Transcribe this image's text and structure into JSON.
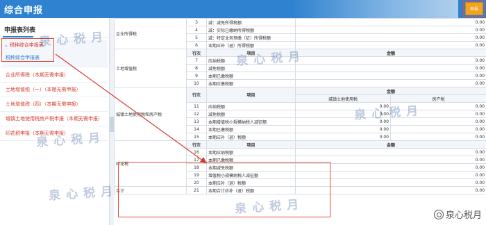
{
  "header": {
    "title": "综合申报",
    "submit_label": "申报"
  },
  "sidebar": {
    "title": "申报表列表",
    "group_label": "税种综合申报表",
    "group_child": "税种综合申报表",
    "items": [
      "企业所得税（本期无需申报）",
      "土地增值税（一）（本期无需申报）",
      "土地增值税（四）（本期无需申报）",
      "城镇土地使用税房产税申报（本期无需申报）",
      "印花税申报（本期无需申报）"
    ]
  },
  "table": {
    "header_item": "项目",
    "header_row": "行次",
    "header_amount": "金额",
    "header_land_tax": "城镇土地使用税",
    "header_property_tax": "房产税",
    "categories": {
      "enterprise": "企业所得税",
      "land_vat": "土地增值税",
      "land_use": "城镇土地使用税和房产税",
      "stamp": "印花税",
      "total": "合计"
    },
    "enterprise_rows": [
      {
        "no": "3",
        "item": "减：减免所得税额",
        "value": "0.00"
      },
      {
        "no": "4",
        "item": "减：实际已缴纳所得税额",
        "value": "0.00"
      },
      {
        "no": "5",
        "item": "减：特定业务预缴（征）所得税额",
        "value": "0.00"
      },
      {
        "no": "6",
        "item": "本期应补（退）所得税额",
        "value": "0.00"
      }
    ],
    "land_vat_rows": [
      {
        "no": "7",
        "item": "应纳税额",
        "value": "0.00"
      },
      {
        "no": "8",
        "item": "减免税额",
        "value": "0.00"
      },
      {
        "no": "9",
        "item": "本期已缴税额",
        "value": "0.00"
      },
      {
        "no": "10",
        "item": "本期应缴税额",
        "value": "0.00"
      }
    ],
    "land_use_rows": [
      {
        "no": "11",
        "item": "应纳税额",
        "land": "0.00",
        "prop": "0.00"
      },
      {
        "no": "12",
        "item": "减免税额",
        "land": "0.00",
        "prop": "0.00"
      },
      {
        "no": "13",
        "item": "本期增值税小规模纳税人减征额",
        "land": "0.00",
        "prop": "0.00"
      },
      {
        "no": "14",
        "item": "本期已缴税额",
        "land": "0.00",
        "prop": "0.00"
      },
      {
        "no": "15",
        "item": "本期应补（退）税额",
        "land": "0.00",
        "prop": "0.00"
      }
    ],
    "stamp_rows": [
      {
        "no": "16",
        "item": "本期应纳税额",
        "value": "0.00"
      },
      {
        "no": "17",
        "item": "本期已缴税额",
        "value": "0.00"
      },
      {
        "no": "18",
        "item": "本期减免税额",
        "value": "0.00"
      },
      {
        "no": "19",
        "item": "增值税小规模纳税人减征额",
        "value": "0.00"
      },
      {
        "no": "20",
        "item": "本期应补（退）税额",
        "value": "0.00"
      }
    ],
    "total_row": {
      "no": "21",
      "item": "本期合计应补（退）税额",
      "value": "0.00"
    }
  },
  "watermark": "泉心税月",
  "brand": "泉心税月",
  "colors": {
    "header": "#2f82cf",
    "accent_red": "#e24b3b",
    "link_blue": "#2f82cf",
    "submit": "#f4a21f"
  }
}
